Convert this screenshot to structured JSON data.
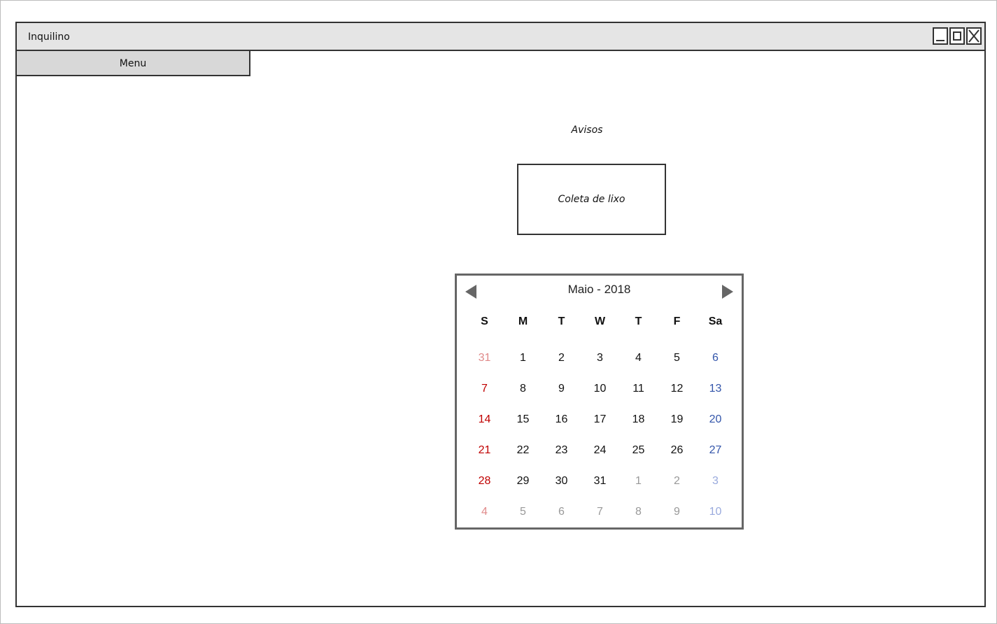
{
  "window": {
    "title": "Inquilino"
  },
  "menu": {
    "label": "Menu"
  },
  "notices": {
    "heading": "Avisos",
    "item": "Coleta de lixo"
  },
  "calendar": {
    "title": "Maio - 2018",
    "weekdays": [
      "S",
      "M",
      "T",
      "W",
      "T",
      "F",
      "Sa"
    ],
    "weeks": [
      [
        "31",
        "1",
        "2",
        "3",
        "4",
        "5",
        "6"
      ],
      [
        "7",
        "8",
        "9",
        "10",
        "11",
        "12",
        "13"
      ],
      [
        "14",
        "15",
        "16",
        "17",
        "18",
        "19",
        "20"
      ],
      [
        "21",
        "22",
        "23",
        "24",
        "25",
        "26",
        "27"
      ],
      [
        "28",
        "29",
        "30",
        "31",
        "1",
        "2",
        "3"
      ],
      [
        "4",
        "5",
        "6",
        "7",
        "8",
        "9",
        "10"
      ]
    ],
    "colors": {
      "sunday": "#c00000",
      "saturday": "#3355aa",
      "other_month": "#999999"
    }
  }
}
